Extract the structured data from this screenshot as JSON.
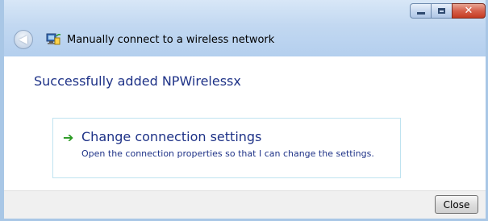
{
  "window": {
    "title": "Manually connect to a wireless network",
    "controls": {
      "minimize": "minimize-icon",
      "maximize": "maximize-icon",
      "close": "close-icon"
    }
  },
  "nav": {
    "back_icon": "back-arrow-icon",
    "network_icon": "wireless-network-icon"
  },
  "content": {
    "heading": "Successfully added NPWirelessx",
    "command_link": {
      "icon": "green-arrow-icon",
      "title": "Change connection settings",
      "description": "Open the connection properties so that I can change the settings."
    }
  },
  "footer": {
    "close_label": "Close"
  },
  "colors": {
    "heading_text": "#1e3287",
    "command_link_border": "#bfe3f0",
    "arrow_green": "#2a9a23",
    "close_button_red": "#c43c22"
  }
}
